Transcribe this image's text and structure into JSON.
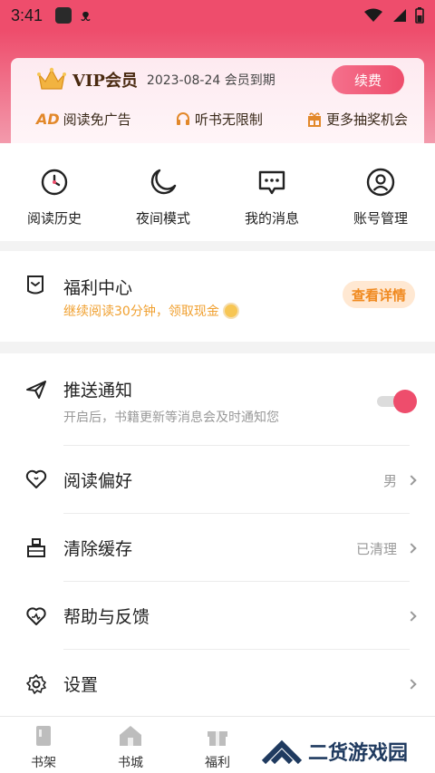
{
  "statusbar": {
    "time": "3:41",
    "app_glyph": "ᴥ"
  },
  "vip": {
    "title": "VIP会员",
    "expire": "2023-08-24 会员到期",
    "renew_label": "续费",
    "benefits": [
      {
        "badge": "AD",
        "label": "阅读免广告",
        "icon": "ad-icon"
      },
      {
        "label": "听书无限制",
        "icon": "headphones-icon"
      },
      {
        "label": "更多抽奖机会",
        "icon": "gift-icon"
      }
    ]
  },
  "quick": [
    {
      "label": "阅读历史",
      "icon": "clock-icon"
    },
    {
      "label": "夜间模式",
      "icon": "moon-icon"
    },
    {
      "label": "我的消息",
      "icon": "message-icon"
    },
    {
      "label": "账号管理",
      "icon": "user-icon"
    }
  ],
  "welfare": {
    "title": "福利中心",
    "subtitle": "继续阅读30分钟，领取现金",
    "button": "查看详情"
  },
  "settings": {
    "push": {
      "label": "推送通知",
      "desc": "开启后，书籍更新等消息会及时通知您",
      "enabled": true
    },
    "preference": {
      "label": "阅读偏好",
      "value": "男"
    },
    "cache": {
      "label": "清除缓存",
      "value": "已清理"
    },
    "help": {
      "label": "帮助与反馈"
    },
    "setup": {
      "label": "设置"
    }
  },
  "tabs": [
    {
      "label": "书架",
      "icon": "bookshelf-icon"
    },
    {
      "label": "书城",
      "icon": "store-icon"
    },
    {
      "label": "福利",
      "icon": "gift-icon"
    }
  ],
  "watermark": {
    "text": "二货游戏园"
  },
  "colors": {
    "accent": "#ee4d6c",
    "orange": "#f08a20"
  }
}
